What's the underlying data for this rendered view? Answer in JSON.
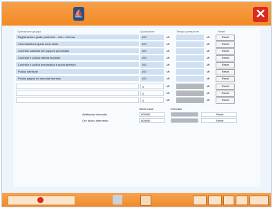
{
  "colors": {
    "title_bar": "#f28a25",
    "close_button": "#d92b1e",
    "row_fill": "#cfe0f2",
    "grey_cell": "#b3b8bd"
  },
  "title_bar": {
    "logo_icon": "blue-sail-logo-icon",
    "close_icon": "close-x-icon"
  },
  "table": {
    "headers": {
      "name": "Operazione gruppo",
      "value": "Quotazione",
      "column2": "Tempo operazione",
      "action": "Reset"
    },
    "rows": [
      {
        "label": "Registrazione guida posteriore - rimb. / ricerca",
        "value": "100",
        "unit": "Mt",
        "action": "Reset"
      },
      {
        "label": "Commutazione guida zona sinist",
        "value": "100",
        "unit": "Mt",
        "action": "Reset"
      },
      {
        "label": "Controllo cassetto dei supporti pneumatici",
        "value": "100",
        "unit": "Mt",
        "action": "Reset"
      },
      {
        "label": "Controllo e pulizia interna impianto",
        "value": "100",
        "unit": "Mt",
        "action": "Reset"
      },
      {
        "label": "Controllo e pulizia pneumatica e guida aperture",
        "value": "100",
        "unit": "Mt",
        "action": "Reset"
      },
      {
        "label": "Pulizia lubrificati",
        "value": "100",
        "unit": "Mt",
        "action": "Reset"
      },
      {
        "label": "Pulizia pagina ed annodati identica",
        "value": "100",
        "unit": "Mt",
        "action": "Reset"
      },
      {
        "label": "",
        "value": "0",
        "unit": "Mt",
        "action": "Reset"
      },
      {
        "label": "",
        "value": "0",
        "unit": "Mt",
        "action": "Reset"
      },
      {
        "label": "",
        "value": "0",
        "unit": "Mt",
        "action": "Reset"
      }
    ],
    "pct_unit": "Mt"
  },
  "summary": {
    "col_head_1": "Valore base",
    "col_head_2": "Intervallo",
    "rows": [
      {
        "label": "Abilitazioni intervallo",
        "value": "000000",
        "action": "Reset"
      },
      {
        "label": "Ore lavoro intervento",
        "value": "000000",
        "action": "Reset"
      }
    ]
  },
  "taskbar": {
    "icons": [
      "stop-icon",
      "tools-icon",
      "folder-icon",
      "hand-icon",
      "clock-icon",
      "user-icon",
      "calendar-icon",
      "network-icon"
    ]
  }
}
